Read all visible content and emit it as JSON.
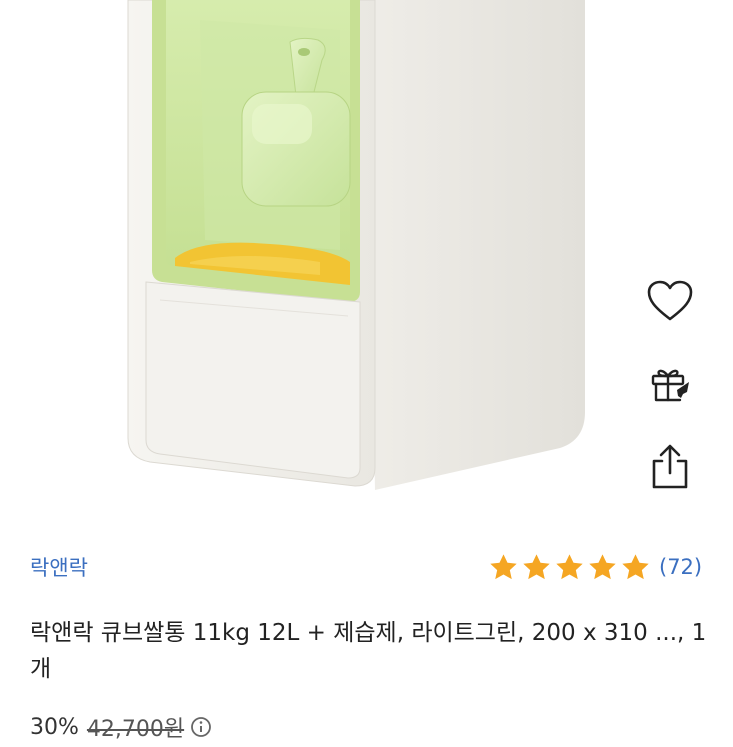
{
  "product": {
    "brand": "락앤락",
    "title": "락앤락 큐브쌀통 11kg 12L + 제습제, 라이트그린, 200 x 310 ..., 1개",
    "rating": {
      "stars": 5,
      "count_label": "(72)"
    },
    "price": {
      "discount_label": "30%",
      "original_label": "42,700원"
    }
  },
  "actions": {
    "wishlist_icon": "heart-icon",
    "gift_icon": "gift-icon",
    "share_icon": "share-icon"
  },
  "colors": {
    "accent_link": "#3b6fc0",
    "star": "#f5a623",
    "container_body": "#f1efea",
    "window_green": "#cfe7a1",
    "scoop_green": "#d7eeb0",
    "rice_yellow": "#f2c433"
  }
}
